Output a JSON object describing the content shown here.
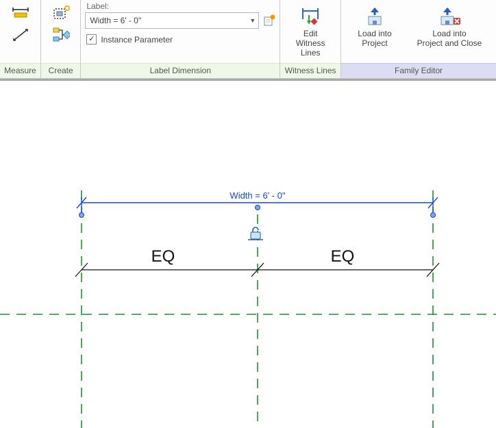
{
  "ribbon": {
    "measure": {
      "label": "Measure"
    },
    "create": {
      "label": "Create"
    },
    "label_dimension": {
      "caption": "Label:",
      "selected": "Width = 6' - 0\"",
      "instance_param_label": "Instance Parameter",
      "instance_param_checked": true,
      "panel_label": "Label Dimension"
    },
    "witness": {
      "edit_line1": "Edit",
      "edit_line2": "Witness Lines",
      "panel_label": "Witness Lines"
    },
    "family_editor": {
      "load_line1": "Load into",
      "load_line2": "Project",
      "load_close_line1": "Load into",
      "load_close_line2": "Project and Close",
      "panel_label": "Family Editor"
    }
  },
  "canvas": {
    "dimension_label": "Width = 6' - 0\"",
    "eq_left": "EQ",
    "eq_right": "EQ",
    "colors": {
      "dimension": "#1846d8",
      "reference": "#1f8f2b"
    }
  }
}
